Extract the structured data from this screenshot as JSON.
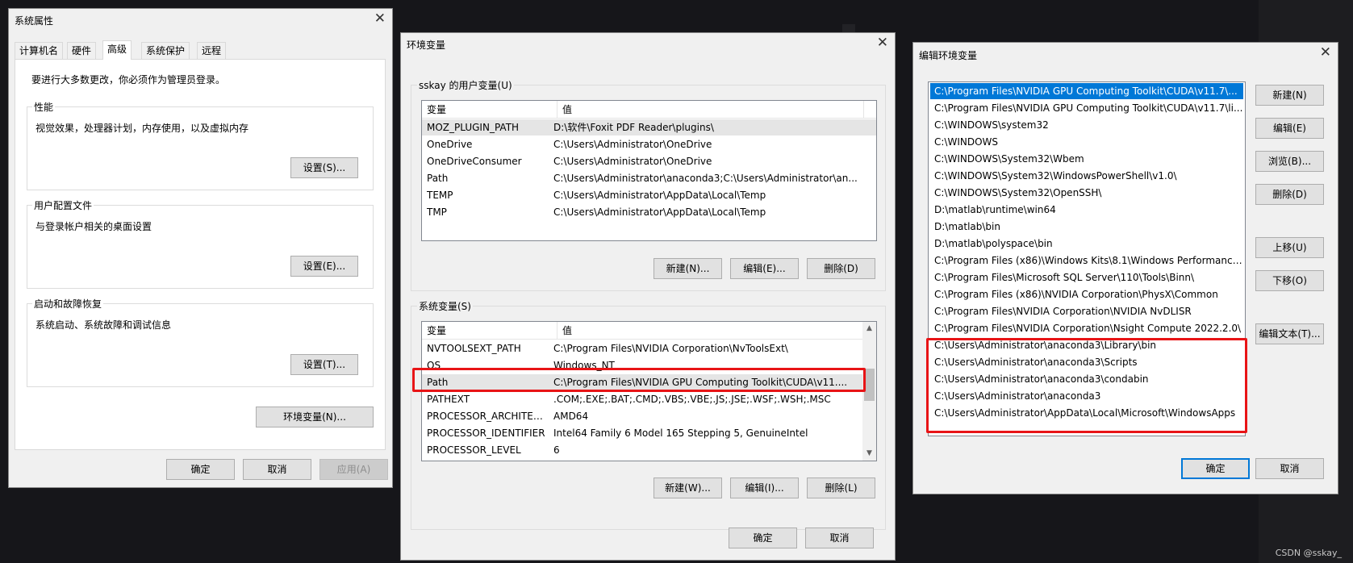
{
  "system_properties": {
    "title": "系统属性",
    "tabs": [
      "计算机名",
      "硬件",
      "高级",
      "系统保护",
      "远程"
    ],
    "admin_note": "要进行大多数更改，你必须作为管理员登录。",
    "performance": {
      "title": "性能",
      "desc": "视觉效果，处理器计划，内存使用，以及虚拟内存",
      "button": "设置(S)..."
    },
    "user_profiles": {
      "title": "用户配置文件",
      "desc": "与登录帐户相关的桌面设置",
      "button": "设置(E)..."
    },
    "startup_recovery": {
      "title": "启动和故障恢复",
      "desc": "系统启动、系统故障和调试信息",
      "button": "设置(T)..."
    },
    "env_button": "环境变量(N)...",
    "ok": "确定",
    "cancel": "取消",
    "apply": "应用(A)"
  },
  "env_vars": {
    "title": "环境变量",
    "user_section": "sskay 的用户变量(U)",
    "system_section": "系统变量(S)",
    "columns": [
      "变量",
      "值"
    ],
    "user_vars": [
      [
        "MOZ_PLUGIN_PATH",
        "D:\\软件\\Foxit PDF Reader\\plugins\\"
      ],
      [
        "OneDrive",
        "C:\\Users\\Administrator\\OneDrive"
      ],
      [
        "OneDriveConsumer",
        "C:\\Users\\Administrator\\OneDrive"
      ],
      [
        "Path",
        "C:\\Users\\Administrator\\anaconda3;C:\\Users\\Administrator\\an..."
      ],
      [
        "TEMP",
        "C:\\Users\\Administrator\\AppData\\Local\\Temp"
      ],
      [
        "TMP",
        "C:\\Users\\Administrator\\AppData\\Local\\Temp"
      ]
    ],
    "user_buttons": {
      "new": "新建(N)...",
      "edit": "编辑(E)...",
      "delete": "删除(D)"
    },
    "system_vars": [
      [
        "NVTOOLSEXT_PATH",
        "C:\\Program Files\\NVIDIA Corporation\\NvToolsExt\\"
      ],
      [
        "OS",
        "Windows_NT"
      ],
      [
        "Path",
        "C:\\Program Files\\NVIDIA GPU Computing Toolkit\\CUDA\\v11...."
      ],
      [
        "PATHEXT",
        ".COM;.EXE;.BAT;.CMD;.VBS;.VBE;.JS;.JSE;.WSF;.WSH;.MSC"
      ],
      [
        "PROCESSOR_ARCHITECT...",
        "AMD64"
      ],
      [
        "PROCESSOR_IDENTIFIER",
        "Intel64 Family 6 Model 165 Stepping 5, GenuineIntel"
      ],
      [
        "PROCESSOR_LEVEL",
        "6"
      ]
    ],
    "system_buttons": {
      "new": "新建(W)...",
      "edit": "编辑(I)...",
      "delete": "删除(L)"
    },
    "ok": "确定",
    "cancel": "取消"
  },
  "edit_env": {
    "title": "编辑环境变量",
    "paths": [
      "C:\\Program Files\\NVIDIA GPU Computing Toolkit\\CUDA\\v11.7\\...",
      "C:\\Program Files\\NVIDIA GPU Computing Toolkit\\CUDA\\v11.7\\li...",
      "C:\\WINDOWS\\system32",
      "C:\\WINDOWS",
      "C:\\WINDOWS\\System32\\Wbem",
      "C:\\WINDOWS\\System32\\WindowsPowerShell\\v1.0\\",
      "C:\\WINDOWS\\System32\\OpenSSH\\",
      "D:\\matlab\\runtime\\win64",
      "D:\\matlab\\bin",
      "D:\\matlab\\polyspace\\bin",
      "C:\\Program Files (x86)\\Windows Kits\\8.1\\Windows Performance...",
      "C:\\Program Files\\Microsoft SQL Server\\110\\Tools\\Binn\\",
      "C:\\Program Files (x86)\\NVIDIA Corporation\\PhysX\\Common",
      "C:\\Program Files\\NVIDIA Corporation\\NVIDIA NvDLISR",
      "C:\\Program Files\\NVIDIA Corporation\\Nsight Compute 2022.2.0\\",
      "C:\\Users\\Administrator\\anaconda3\\Library\\bin",
      "C:\\Users\\Administrator\\anaconda3\\Scripts",
      "C:\\Users\\Administrator\\anaconda3\\condabin",
      "C:\\Users\\Administrator\\anaconda3",
      "C:\\Users\\Administrator\\AppData\\Local\\Microsoft\\WindowsApps"
    ],
    "buttons": {
      "new": "新建(N)",
      "edit": "编辑(E)",
      "browse": "浏览(B)...",
      "delete": "删除(D)",
      "move_up": "上移(U)",
      "move_down": "下移(O)",
      "edit_text": "编辑文本(T)..."
    },
    "ok": "确定",
    "cancel": "取消"
  },
  "watermark": "CSDN @sskay_",
  "colors": {
    "highlight_box": "#e81416",
    "selection": "#0078d7",
    "background": "#16161a"
  }
}
